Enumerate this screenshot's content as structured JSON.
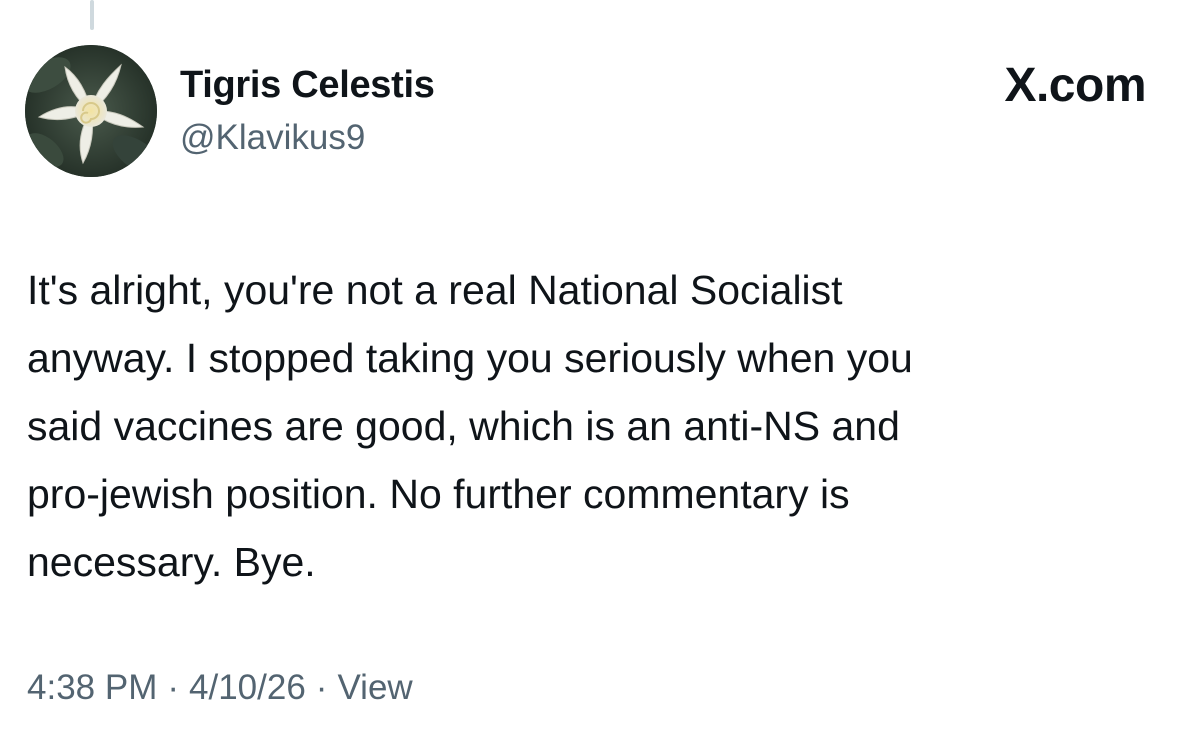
{
  "post": {
    "author": {
      "display_name": "Tigris Celestis",
      "handle": "@Klavikus9",
      "avatar": "flower-avatar"
    },
    "source": "X.com",
    "text": "It's alright, you're not a real National Socialist\nanyway. I stopped taking you seriously when you\nsaid vaccines are good, which is an anti-NS and\npro-jewish position. No further commentary is\nnecessary. Bye.",
    "time": "4:38 PM",
    "date": "4/10/26",
    "separator": "·",
    "views_label": "View"
  },
  "colors": {
    "text_primary": "#0f1419",
    "text_secondary": "#536471",
    "thread_line": "#cfd9de"
  }
}
